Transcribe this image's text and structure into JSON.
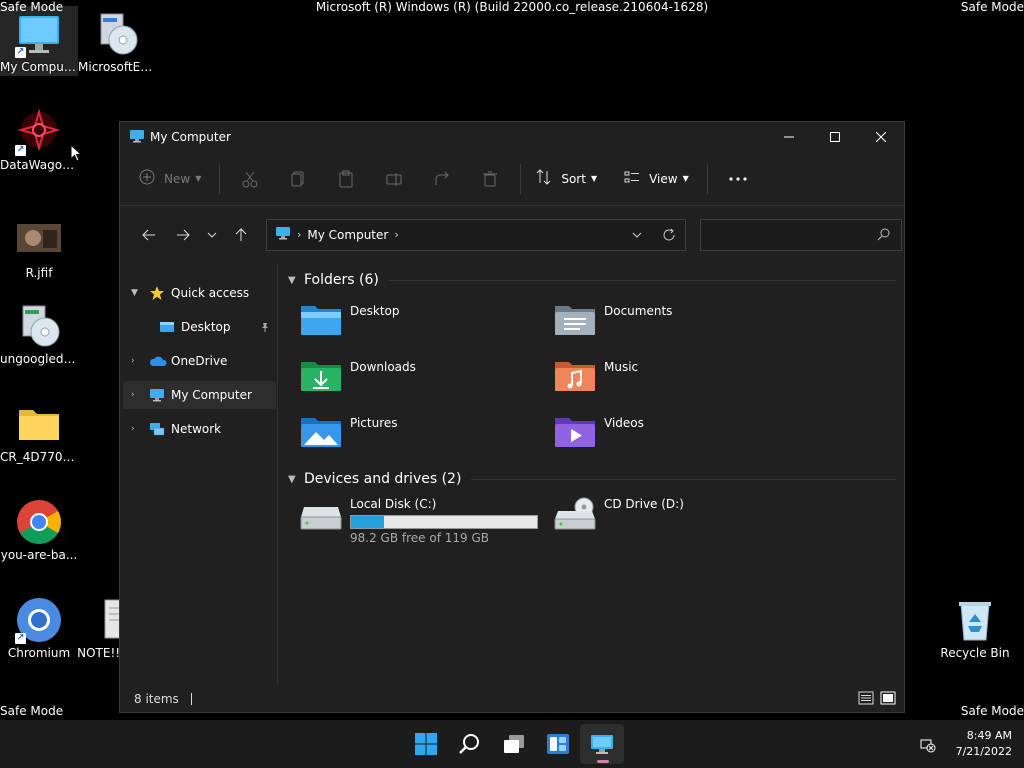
{
  "overlay": {
    "safe_mode": "Safe Mode",
    "build": "Microsoft (R) Windows (R) (Build 22000.co_release.210604-1628)"
  },
  "desktop": {
    "icons": [
      {
        "label": "My Computer",
        "icon": "monitor-icon"
      },
      {
        "label": "MicrosoftEd...",
        "icon": "installer-icon"
      },
      {
        "label": "DataWagon...",
        "icon": "app-icon"
      },
      {
        "label": "R.jfif",
        "icon": "image-icon"
      },
      {
        "label": "ungoogled-...",
        "icon": "installer-icon"
      },
      {
        "label": "CR_4D770.t...",
        "icon": "folder-icon"
      },
      {
        "label": "you-are-ba...",
        "icon": "chrome-icon"
      },
      {
        "label": "Chromium",
        "icon": "chromium-icon"
      },
      {
        "label": "NOTE!!!",
        "icon": "text-file-icon"
      },
      {
        "label": "Recycle Bin",
        "icon": "recycle-bin-icon"
      }
    ]
  },
  "window": {
    "title": "My Computer",
    "toolbar": {
      "new_label": "New",
      "sort_label": "Sort",
      "view_label": "View"
    },
    "address": {
      "crumb": "My Computer",
      "search_placeholder": ""
    },
    "nav": {
      "quick_access": "Quick access",
      "desktop": "Desktop",
      "onedrive": "OneDrive",
      "my_computer": "My Computer",
      "network": "Network"
    },
    "folders_header": "Folders (6)",
    "folders": [
      {
        "name": "Desktop",
        "color": "#2f9fe8"
      },
      {
        "name": "Documents",
        "color": "#8d9aa8"
      },
      {
        "name": "Downloads",
        "color": "#23a35a"
      },
      {
        "name": "Music",
        "color": "#e8774a"
      },
      {
        "name": "Pictures",
        "color": "#2e8fe0"
      },
      {
        "name": "Videos",
        "color": "#8b5bd8"
      }
    ],
    "drives_header": "Devices and drives (2)",
    "drives": {
      "local_name": "Local Disk (C:)",
      "local_free": "98.2 GB free of 119 GB",
      "local_used_fraction": 0.175,
      "cd_name": "CD Drive (D:)"
    },
    "status": {
      "items": "8 items"
    }
  },
  "taskbar": {
    "time": "8:49 AM",
    "date": "7/21/2022",
    "accent": "#d47fa6"
  }
}
